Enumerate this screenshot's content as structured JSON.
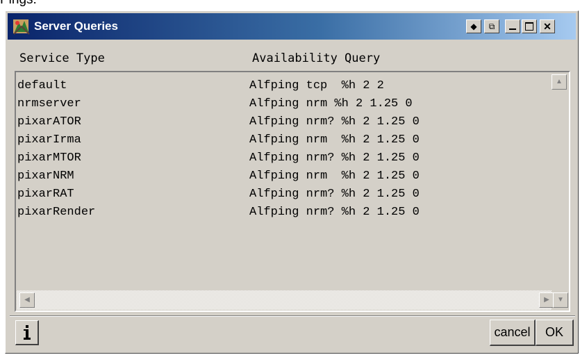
{
  "page": {
    "caption": "Pings:"
  },
  "window": {
    "title": "Server Queries",
    "title_buttons": [
      "pin",
      "restore",
      "minimize",
      "maximize",
      "close"
    ]
  },
  "columns": {
    "service_type": "Service Type",
    "availability_query": "Availability Query"
  },
  "rows": [
    {
      "service": "default",
      "query": "Alfping tcp  %h 2 2"
    },
    {
      "service": "nrmserver",
      "query": "Alfping nrm %h 2 1.25 0"
    },
    {
      "service": "pixarATOR",
      "query": "Alfping nrm? %h 2 1.25 0"
    },
    {
      "service": "pixarIrma",
      "query": "Alfping nrm  %h 2 1.25 0"
    },
    {
      "service": "pixarMTOR",
      "query": "Alfping nrm? %h 2 1.25 0"
    },
    {
      "service": "pixarNRM",
      "query": "Alfping nrm  %h 2 1.25 0"
    },
    {
      "service": "pixarRAT",
      "query": "Alfping nrm? %h 2 1.25 0"
    },
    {
      "service": "pixarRender",
      "query": "Alfping nrm? %h 2 1.25 0"
    }
  ],
  "footer": {
    "info_icon": "info-icon",
    "cancel_label": "cancel",
    "ok_label": "OK"
  },
  "colors": {
    "title_start": "#0a246a",
    "title_end": "#a6caf0",
    "face": "#d4d0c8"
  }
}
